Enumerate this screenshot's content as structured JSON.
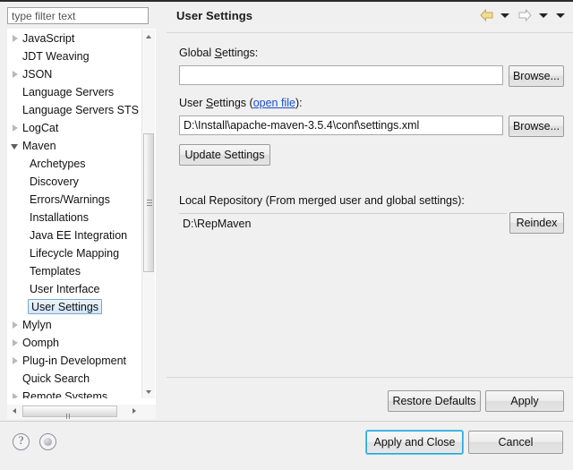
{
  "window": {
    "title": "User Settings"
  },
  "sidebar": {
    "filter": {
      "placeholder": "type filter text",
      "value": ""
    },
    "tree": [
      {
        "label": "JavaScript",
        "level": 1,
        "state": "collapsed"
      },
      {
        "label": "JDT Weaving",
        "level": 1,
        "state": "leaf"
      },
      {
        "label": "JSON",
        "level": 1,
        "state": "collapsed"
      },
      {
        "label": "Language Servers",
        "level": 1,
        "state": "leaf"
      },
      {
        "label": "Language Servers STS",
        "level": 1,
        "state": "leaf"
      },
      {
        "label": "LogCat",
        "level": 1,
        "state": "collapsed"
      },
      {
        "label": "Maven",
        "level": 1,
        "state": "expanded"
      },
      {
        "label": "Archetypes",
        "level": 2,
        "state": "leaf"
      },
      {
        "label": "Discovery",
        "level": 2,
        "state": "leaf"
      },
      {
        "label": "Errors/Warnings",
        "level": 2,
        "state": "leaf"
      },
      {
        "label": "Installations",
        "level": 2,
        "state": "leaf"
      },
      {
        "label": "Java EE Integration",
        "level": 2,
        "state": "leaf"
      },
      {
        "label": "Lifecycle Mapping",
        "level": 2,
        "state": "leaf"
      },
      {
        "label": "Templates",
        "level": 2,
        "state": "leaf"
      },
      {
        "label": "User Interface",
        "level": 2,
        "state": "leaf"
      },
      {
        "label": "User Settings",
        "level": 2,
        "state": "leaf",
        "selected": true
      },
      {
        "label": "Mylyn",
        "level": 1,
        "state": "collapsed"
      },
      {
        "label": "Oomph",
        "level": 1,
        "state": "collapsed"
      },
      {
        "label": "Plug-in Development",
        "level": 1,
        "state": "collapsed"
      },
      {
        "label": "Quick Search",
        "level": 1,
        "state": "leaf"
      },
      {
        "label": "Remote Systems",
        "level": 1,
        "state": "collapsed"
      }
    ]
  },
  "header": {
    "title": "User Settings",
    "nav": {
      "back_icon": "back-arrow-icon",
      "back_dropdown_icon": "chevron-down-icon",
      "forward_icon": "forward-arrow-icon",
      "forward_dropdown_icon": "chevron-down-icon",
      "menu_icon": "chevron-down-icon"
    }
  },
  "page": {
    "global_settings": {
      "label_pre": "Global ",
      "label_mnemonic": "S",
      "label_post": "ettings:",
      "value": "",
      "placeholder": "",
      "browse_label": "Browse..."
    },
    "user_settings": {
      "label_pre": "User ",
      "label_mnemonic": "S",
      "label_mid": "ettings (",
      "link_label": "open file",
      "label_post": "):",
      "value": "D:\\Install\\apache-maven-3.5.4\\conf\\settings.xml",
      "browse_label": "Browse..."
    },
    "update_settings_label": "Update Settings",
    "local_repository": {
      "label": "Local Repository (From merged user and global settings):",
      "value": "D:\\RepMaven",
      "reindex_label": "Reindex",
      "readonly": true
    },
    "restore_defaults_label": "Restore Defaults",
    "apply_label": "Apply"
  },
  "footer": {
    "help_icon": "question-mark-icon",
    "contributor_icon": "contributor-icon",
    "apply_and_close_label": "Apply and Close",
    "cancel_label": "Cancel"
  },
  "colors": {
    "accent_focus": "#2ba8d8",
    "link": "#1a4fcf",
    "selection_fill": "#d3e6f7",
    "selection_border": "#7ea7cd",
    "back_arrow": "#e9d48a",
    "background": "#f0f0f0"
  }
}
